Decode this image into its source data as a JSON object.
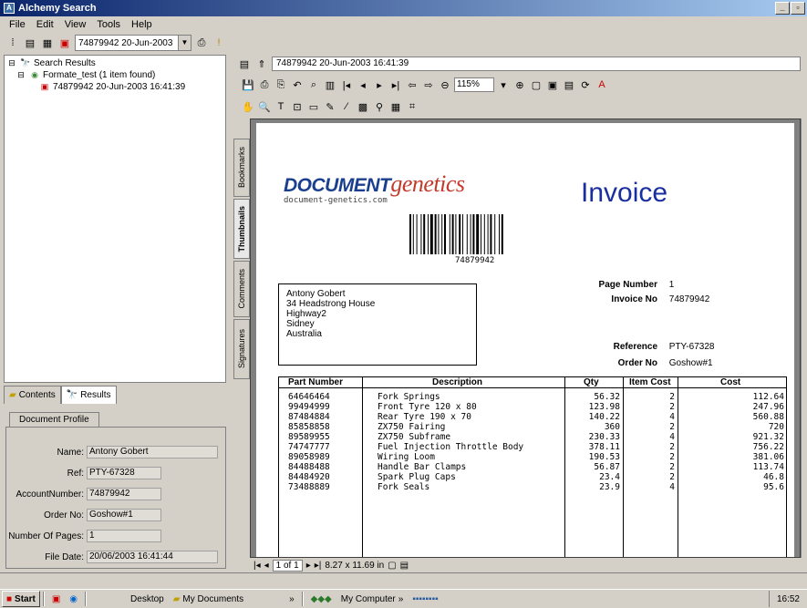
{
  "window": {
    "title": "Alchemy Search"
  },
  "menu": [
    "File",
    "Edit",
    "View",
    "Tools",
    "Help"
  ],
  "toolbar": {
    "doc_select": "74879942 20-Jun-2003"
  },
  "tree": {
    "root": "Search Results",
    "child": "Formate_test (1 item found)",
    "leaf": "74879942 20-Jun-2003 16:41:39"
  },
  "left_tabs": {
    "contents": "Contents",
    "results": "Results"
  },
  "profile": {
    "tab": "Document Profile",
    "fields": [
      {
        "label": "Name:",
        "value": "Antony Gobert"
      },
      {
        "label": "Ref:",
        "value": "PTY-67328"
      },
      {
        "label": "AccountNumber:",
        "value": "74879942"
      },
      {
        "label": "Order No:",
        "value": "Goshow#1"
      },
      {
        "label": "Number Of Pages:",
        "value": "1"
      },
      {
        "label": "File Date:",
        "value": "20/06/2003 16:41:44"
      }
    ]
  },
  "viewer": {
    "path": "74879942 20-Jun-2003 16:41:39",
    "zoom": "115%",
    "side_tabs": [
      "Bookmarks",
      "Thumbnails",
      "Comments",
      "Signatures"
    ],
    "nav": {
      "page": "1 of 1",
      "size": "8.27 x 11.69 in"
    }
  },
  "invoice": {
    "logo_main": "DOCUMENT",
    "logo_accent": "genetics",
    "logo_url": "document-genetics.com",
    "title": "Invoice",
    "barcode_number": "74879942",
    "address": [
      "Antony Gobert",
      "34 Headstrong House",
      "Highway2",
      "Sidney",
      "Australia"
    ],
    "page_number_label": "Page Number",
    "page_number": "1",
    "invoice_no_label": "Invoice No",
    "invoice_no": "74879942",
    "reference_label": "Reference",
    "reference": "PTY-67328",
    "order_no_label": "Order No",
    "order_no": "Goshow#1",
    "columns": [
      "Part Number",
      "Description",
      "Qty",
      "Item Cost",
      "Cost"
    ],
    "rows": [
      {
        "part": "64646464",
        "desc": "Fork Springs",
        "qty": "56.32",
        "item": "2",
        "cost": "112.64"
      },
      {
        "part": "99494999",
        "desc": "Front Tyre 120 x 80",
        "qty": "123.98",
        "item": "2",
        "cost": "247.96"
      },
      {
        "part": "87484884",
        "desc": "Rear Tyre 190 x 70",
        "qty": "140.22",
        "item": "4",
        "cost": "560.88"
      },
      {
        "part": "85858858",
        "desc": "ZX750 Fairing",
        "qty": "360",
        "item": "2",
        "cost": "720"
      },
      {
        "part": "89589955",
        "desc": "ZX750 Subframe",
        "qty": "230.33",
        "item": "4",
        "cost": "921.32"
      },
      {
        "part": "74747777",
        "desc": "Fuel Injection Throttle Body",
        "qty": "378.11",
        "item": "2",
        "cost": "756.22"
      },
      {
        "part": "89058989",
        "desc": "Wiring Loom",
        "qty": "190.53",
        "item": "2",
        "cost": "381.06"
      },
      {
        "part": "84488488",
        "desc": "Handle Bar Clamps",
        "qty": "56.87",
        "item": "2",
        "cost": "113.74"
      },
      {
        "part": "84484920",
        "desc": "Spark Plug Caps",
        "qty": "23.4",
        "item": "2",
        "cost": "46.8"
      },
      {
        "part": "73488889",
        "desc": "Fork Seals",
        "qty": "23.9",
        "item": "4",
        "cost": "95.6"
      }
    ]
  },
  "taskbar": {
    "start": "Start",
    "desktop": "Desktop",
    "my_documents": "My Documents",
    "my_computer": "My Computer",
    "clock": "16:52"
  }
}
